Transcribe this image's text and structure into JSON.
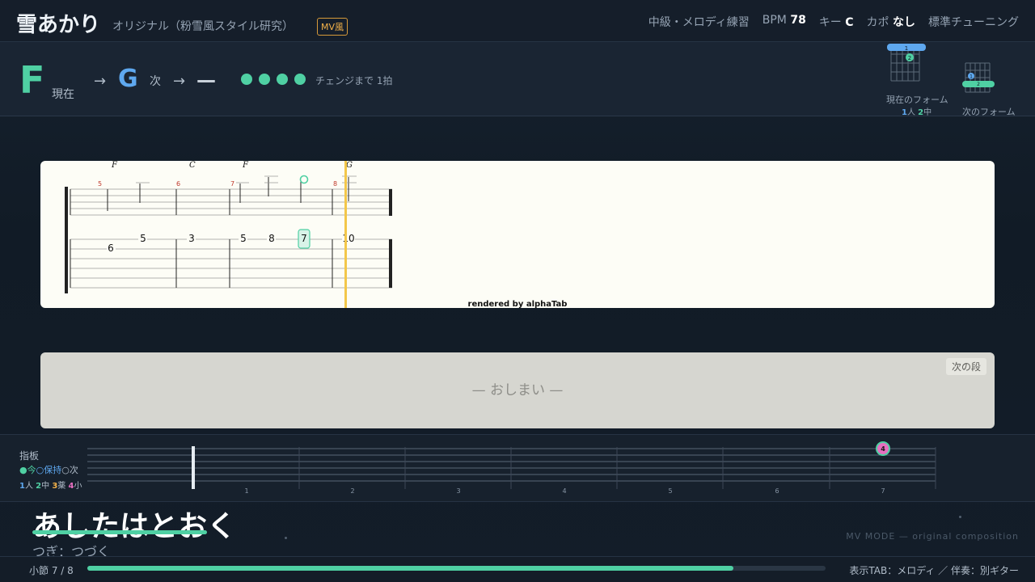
{
  "header": {
    "title": "雪あかり",
    "subtitle": "オリジナル（粉雪風スタイル研究）",
    "badge": "MV風",
    "level": "中級・メロディ練習",
    "bpm_label": "BPM",
    "bpm_value": "78",
    "key_label": "キー",
    "key_value": "C",
    "capo_label": "カポ",
    "capo_value": "なし",
    "tuning": "標準チューニング"
  },
  "chords": {
    "current": "F",
    "current_label": "現在",
    "arrow": "→",
    "next": "G",
    "next_label": "次",
    "after": "—",
    "beats_remaining": 4,
    "change_text": "チェンジまで 1拍",
    "current_form_label": "現在のフォーム",
    "next_form_label": "次のフォーム",
    "current_form_fingers": {
      "f1": "1",
      "f1_name": "人",
      "f2": "2",
      "f2_name": "中"
    },
    "current_form_markers": [
      "1",
      "2"
    ],
    "next_form_markers": [
      "1",
      "2"
    ]
  },
  "tab": {
    "chord_labels": [
      "F",
      "C",
      "F",
      "G"
    ],
    "measure_numbers": [
      "5",
      "6",
      "7",
      "8"
    ],
    "fret_numbers": [
      "6",
      "5",
      "3",
      "5",
      "8",
      "7",
      "10"
    ],
    "credit": "rendered by alphaTab"
  },
  "next_panel": {
    "end_text": "— おしまい —",
    "next_button": "次の段"
  },
  "fretboard": {
    "title": "指板",
    "legend_now": "●今",
    "legend_hold": "○保持",
    "legend_next": "○次",
    "fingers": [
      {
        "num": "1",
        "name": "人"
      },
      {
        "num": "2",
        "name": "中"
      },
      {
        "num": "3",
        "name": "薬"
      },
      {
        "num": "4",
        "name": "小"
      }
    ],
    "fret_labels": [
      "1",
      "2",
      "3",
      "4",
      "5",
      "6",
      "7"
    ],
    "active_finger": "4"
  },
  "lyrics": {
    "current": "あしたはとおく",
    "next": "つぎ：つづく",
    "mv_mode": "MV MODE — original composition"
  },
  "footer": {
    "measure_text": "小節 7 / 8",
    "progress": 0.875,
    "display_info": "表示TAB：メロディ ／ 伴奏：別ギター"
  },
  "colors": {
    "accent": "#4fd0a3",
    "next_chord": "#5ea8ef",
    "playhead": "#f3c74a",
    "finger4": "#e66fc0"
  }
}
